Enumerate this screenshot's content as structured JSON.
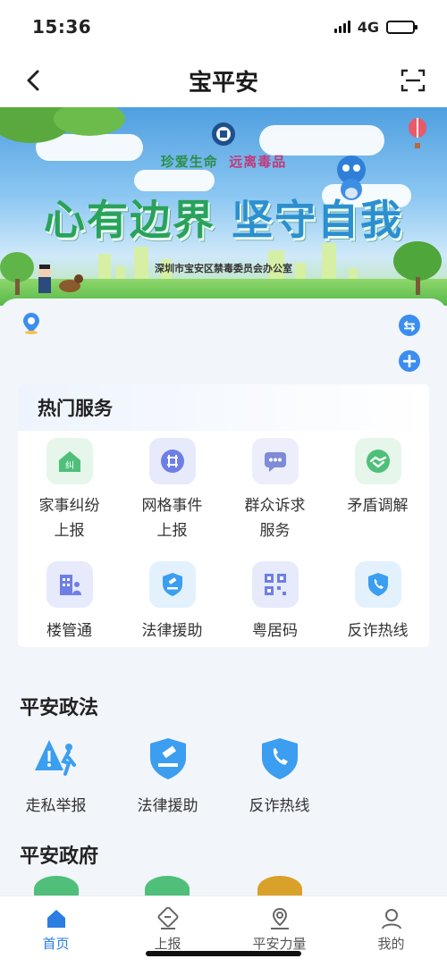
{
  "status_bar": {
    "time": "15:36",
    "network": "4G",
    "battery_level": 1.0
  },
  "nav": {
    "title": "宝平安",
    "back_icon": "back-chevron-icon",
    "scan_icon": "scan-icon"
  },
  "banner": {
    "slogan_small_a": "珍爱生命",
    "slogan_small_b": "远离毒品",
    "slogan_big_a": "心有边界",
    "slogan_big_b": "坚守自我",
    "office": "深圳市宝安区禁毒委员会办公室"
  },
  "hot_services": {
    "title": "热门服务",
    "items": [
      {
        "label": "家事纠纷\n上报",
        "icon": "family-dispute-icon",
        "color": "#4fbf7a",
        "bg": "#e6f6ea"
      },
      {
        "label": "网格事件\n上报",
        "icon": "grid-event-icon",
        "color": "#6d7fe6",
        "bg": "#e7eafb"
      },
      {
        "label": "群众诉求\n服务",
        "icon": "chat-icon",
        "color": "#7d8bd8",
        "bg": "#eceefb"
      },
      {
        "label": "矛盾调解",
        "icon": "handshake-icon",
        "color": "#4fbf7a",
        "bg": "#e6f6ea"
      },
      {
        "label": "楼管通",
        "icon": "building-icon",
        "color": "#6d7fe6",
        "bg": "#e7eafb"
      },
      {
        "label": "法律援助",
        "icon": "law-shield-icon",
        "color": "#3b9ef0",
        "bg": "#e3f1fd"
      },
      {
        "label": "粤居码",
        "icon": "qr-code-icon",
        "color": "#6d7fe6",
        "bg": "#e7eafb"
      },
      {
        "label": "反诈热线",
        "icon": "phone-shield-icon",
        "color": "#3b9ef0",
        "bg": "#e3f1fd"
      }
    ]
  },
  "section_politics": {
    "title": "平安政法",
    "items": [
      {
        "label": "走私举报",
        "icon": "smuggling-report-icon"
      },
      {
        "label": "法律援助",
        "icon": "law-shield-icon"
      },
      {
        "label": "反诈热线",
        "icon": "phone-shield-icon"
      }
    ]
  },
  "section_government": {
    "title": "平安政府"
  },
  "tabbar": {
    "items": [
      {
        "label": "首页",
        "icon": "home-icon",
        "active": true
      },
      {
        "label": "上报",
        "icon": "report-icon",
        "active": false
      },
      {
        "label": "平安力量",
        "icon": "location-person-icon",
        "active": false
      },
      {
        "label": "我的",
        "icon": "profile-icon",
        "active": false
      }
    ]
  },
  "colors": {
    "accent": "#2a7de1",
    "primary_blue": "#3b8ef0",
    "green": "#29a25c"
  }
}
